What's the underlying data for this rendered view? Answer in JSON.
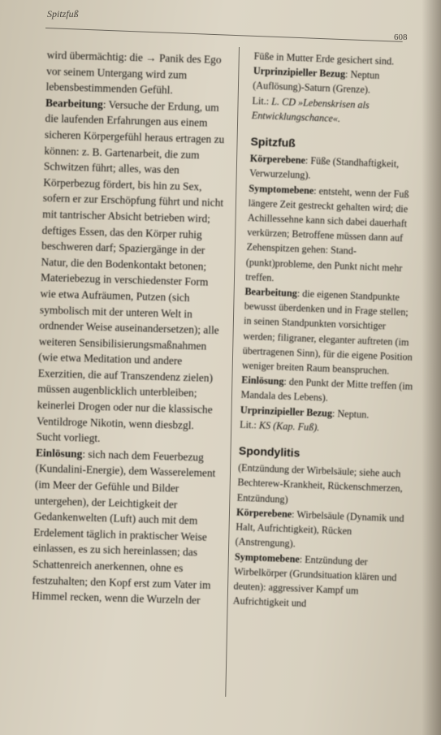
{
  "header": {
    "running_head": "Spitzfuß",
    "page_number": "608"
  },
  "left_column": {
    "intro": "wird übermächtig: die → Panik des Ego vor seinem Untergang wird zum lebensbestimmenden Gefühl.",
    "bearbeitung_label": "Bearbeitung",
    "bearbeitung_text": ": Versuche der Erdung, um die laufenden Erfahrungen aus einem sicheren Körpergefühl heraus ertragen zu können: z. B. Gartenarbeit, die zum Schwitzen führt; alles, was den Körperbezug fördert, bis hin zu Sex, sofern er zur Erschöpfung führt und nicht mit tantrischer Absicht betrieben wird; deftiges Essen, das den Körper ruhig beschweren darf; Spaziergänge in der Natur, die den Bodenkontakt betonen; Materiebezug in verschiedenster Form wie etwa Aufräumen, Putzen (sich symbolisch mit der unteren Welt in ordnender Weise auseinandersetzen); alle weiteren Sensibilisierungsmaßnahmen (wie etwa Meditation und andere Exerzitien, die auf Transzendenz zielen) müssen augenblicklich unterbleiben; keinerlei Drogen oder nur die klassische Ventildroge Nikotin, wenn diesbzgl. Sucht vorliegt.",
    "einloesung_label": "Einlösung",
    "einloesung_text": ": sich nach dem Feuerbezug (Kundalini-Energie), dem Wasserelement (im Meer der Gefühle und Bilder untergehen), der Leichtigkeit der Gedankenwelten (Luft) auch mit dem Erdelement täglich in praktischer Weise einlassen, es zu sich hereinlassen; das Schattenreich anerkennen, ohne es festzuhalten; den Kopf erst zum Vater im Himmel recken, wenn die Wurzeln der"
  },
  "right_column": {
    "continuation": "Füße in Mutter Erde gesichert sind.",
    "urprinzip_label_1": "Urprinzipieller Bezug",
    "urprinzip_text_1": ": Neptun (Auflösung)-Saturn (Grenze).",
    "lit_label_1": "Lit.: ",
    "lit_text_1": "L. CD »Lebenskrisen als Entwicklungschance«.",
    "entry_spitzfuss": {
      "title": "Spitzfuß",
      "koerper_label": "Körperebene",
      "koerper_text": ": Füße (Standhaftigkeit, Verwurzelung).",
      "symptom_label": "Symptomebene",
      "symptom_text": ": entsteht, wenn der Fuß längere Zeit gestreckt gehalten wird; die Achillessehne kann sich dabei dauerhaft verkürzen; Betroffene müssen dann auf Zehenspitzen gehen: Stand-(punkt)probleme, den Punkt nicht mehr treffen.",
      "bearbeitung_label": "Bearbeitung",
      "bearbeitung_text": ": die eigenen Standpunkte bewusst überdenken und in Frage stellen; in seinen Standpunkten vorsichtiger werden; filigraner, eleganter auftreten (im übertragenen Sinn), für die eigene Position weniger breiten Raum beanspruchen.",
      "einloesung_label": "Einlösung",
      "einloesung_text": ": den Punkt der Mitte treffen (im Mandala des Lebens).",
      "urprinzip_label": "Urprinzipieller Bezug",
      "urprinzip_text": ": Neptun.",
      "lit_label": "Lit.: ",
      "lit_text": "KS (Kap. Fuß)."
    },
    "entry_spondylitis": {
      "title": "Spondylitis",
      "intro": "(Entzündung der Wirbelsäule; siehe auch Bechterew-Krankheit, Rückenschmerzen, Entzündung)",
      "koerper_label": "Körperebene",
      "koerper_text": ": Wirbelsäule (Dynamik und Halt, Aufrichtigkeit), Rücken (Anstrengung).",
      "symptom_label": "Symptomebene",
      "symptom_text": ": Entzündung der Wirbelkörper (Grundsituation klären und deuten): aggressiver Kampf um Aufrichtigkeit und"
    }
  }
}
